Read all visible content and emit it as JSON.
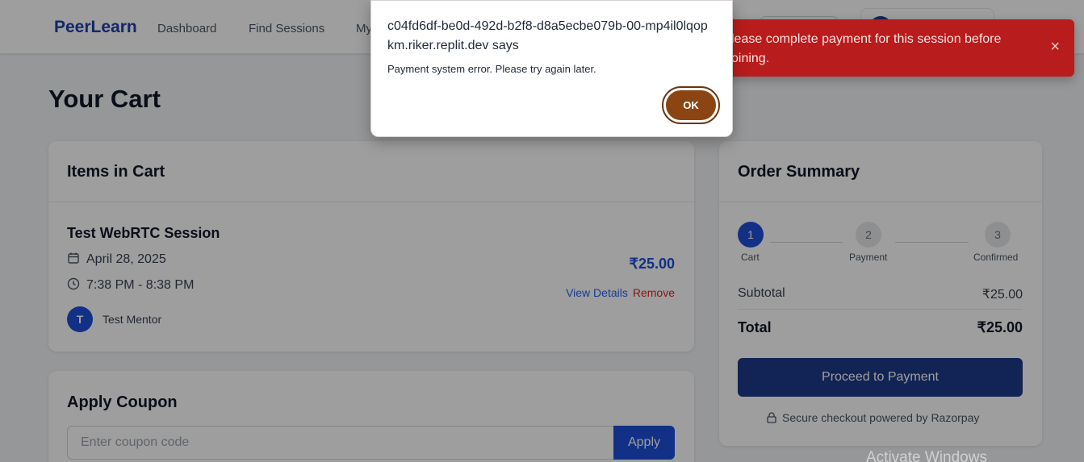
{
  "navbar": {
    "brand": "PeerLearn",
    "links": [
      "Dashboard",
      "Find Sessions",
      "My"
    ]
  },
  "page": {
    "title": "Your Cart"
  },
  "cart": {
    "heading": "Items in Cart",
    "item": {
      "title": "Test WebRTC Session",
      "date": "April 28, 2025",
      "time": "7:38 PM - 8:38 PM",
      "price": "₹25.00",
      "view_details": "View Details",
      "remove": "Remove",
      "mentor_initial": "T",
      "mentor_name": "Test Mentor"
    }
  },
  "coupon": {
    "heading": "Apply Coupon",
    "placeholder": "Enter coupon code",
    "apply_label": "Apply"
  },
  "summary": {
    "heading": "Order Summary",
    "steps": [
      {
        "num": "1",
        "label": "Cart"
      },
      {
        "num": "2",
        "label": "Payment"
      },
      {
        "num": "3",
        "label": "Confirmed"
      }
    ],
    "subtotal_label": "Subtotal",
    "subtotal_value": "₹25.00",
    "total_label": "Total",
    "total_value": "₹25.00",
    "pay_button": "Proceed to Payment",
    "secure_text": "Secure checkout powered by Razorpay"
  },
  "toast": {
    "message": "lease complete payment for this session before oining.",
    "close": "×"
  },
  "dialog": {
    "origin": "c04fd6df-be0d-492d-b2f8-d8a5ecbe079b-00-mp4il0lqopkm.riker.replit.dev says",
    "message": "Payment system error. Please try again later.",
    "ok_label": "OK"
  },
  "watermark": "Activate Windows",
  "colors": {
    "brand": "#1e40af",
    "accent": "#1d4ed8",
    "toast_bg": "#b91c1c",
    "ok_button": "#8b4513"
  }
}
